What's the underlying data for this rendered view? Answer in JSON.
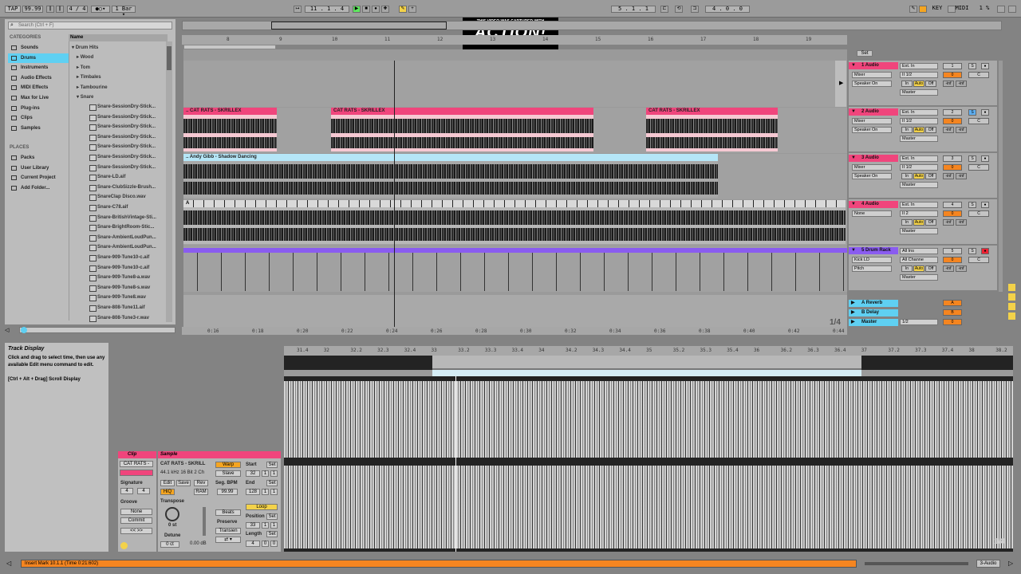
{
  "control_bar": {
    "tap": "TAP",
    "tempo": "99.99",
    "signature": "4 / 4",
    "quantize": "1 Bar",
    "position": "11 . 1 . 4",
    "loop_start": "5 . 1 . 1",
    "loop_length": "4 . 0 . 0",
    "key": "KEY",
    "midi": "MIDI",
    "cpu": "1 %"
  },
  "overlay": {
    "line1": "THIS VIDEO WAS CAPTURED WITH",
    "brand": "ACTION!",
    "url": "WWW.MIRILLIS.COM"
  },
  "browser": {
    "search_placeholder": "Search (Ctrl + F)",
    "categories_title": "CATEGORIES",
    "places_title": "PLACES",
    "name_header": "Name",
    "categories": [
      "Sounds",
      "Drums",
      "Instruments",
      "Audio Effects",
      "MIDI Effects",
      "Max for Live",
      "Plug-ins",
      "Clips",
      "Samples"
    ],
    "places": [
      "Packs",
      "User Library",
      "Current Project",
      "Add Folder..."
    ],
    "root": "Drum Hits",
    "folders": [
      "Wood",
      "Tom",
      "Timbales",
      "Tambourine",
      "Snare"
    ],
    "files": [
      "Snare-SessionDry-Stick...",
      "Snare-SessionDry-Stick...",
      "Snare-SessionDry-Stick...",
      "Snare-SessionDry-Stick...",
      "Snare-SessionDry-Stick...",
      "Snare-SessionDry-Stick...",
      "Snare-SessionDry-Stick...",
      "Snare-LD.aif",
      "Snare-ClubSizzle-Brush...",
      "SnareClap Disco.wav",
      "Snare-C78.aif",
      "Snare-BritishVintage-Sti...",
      "Snare-BrightRoom-Stic...",
      "Snare-AmbientLoudPun...",
      "Snare-AmbientLoudPun...",
      "Snare-909-Tune10-c.aif",
      "Snare-909-Tune10-c.aif",
      "Snare-909-Tune8-a.wav",
      "Snare-909-Tune8-s.wav",
      "Snare-909-Tune8.wav",
      "Snare-808-Tune11.aif",
      "Snare-808-Tune3-r.wav"
    ]
  },
  "ruler": [
    "8",
    "9",
    "10",
    "11",
    "12",
    "13",
    "14",
    "15",
    "16",
    "17",
    "18",
    "19"
  ],
  "time_ruler": [
    "0:16",
    "0:18",
    "0:20",
    "0:22",
    "0:24",
    "0:26",
    "0:28",
    "0:30",
    "0:32",
    "0:34",
    "0:36",
    "0:38",
    "0:40",
    "0:42",
    "0:44"
  ],
  "clips": {
    "track2": "CAT RATS - SKRILLEX",
    "track3": "Andy Gibb - Shadow Dancing",
    "track4_slice": "A"
  },
  "grid_fraction": "1/4",
  "tracks": [
    {
      "name": "1 Audio",
      "color": "#f0457c",
      "input": "Ext. In",
      "channel": "II 1/2",
      "monitor": "Mixer",
      "output": "Speaker On",
      "dest": "Master",
      "num": "1",
      "vol": "0",
      "pan": "C",
      "inf1": "-inf",
      "inf2": "-inf"
    },
    {
      "name": "2 Audio",
      "color": "#f0457c",
      "input": "Ext. In",
      "channel": "II 1/2",
      "monitor": "Mixer",
      "output": "Speaker On",
      "dest": "Master",
      "num": "2",
      "vol": "0",
      "pan": "C",
      "inf1": "-inf",
      "inf2": "-inf"
    },
    {
      "name": "3 Audio",
      "color": "#f0457c",
      "input": "Ext. In",
      "channel": "II 1/2",
      "monitor": "Mixer",
      "output": "Speaker On",
      "dest": "Master",
      "num": "3",
      "vol": "0",
      "pan": "C",
      "inf1": "-inf",
      "inf2": "-inf"
    },
    {
      "name": "4 Audio",
      "color": "#f0457c",
      "input": "Ext. In",
      "channel": "II 2",
      "monitor": "None",
      "output": "",
      "dest": "Master",
      "num": "4",
      "vol": "0",
      "pan": "C",
      "inf1": "-inf",
      "inf2": "-inf"
    },
    {
      "name": "5 Drum Rack",
      "color": "#8a5cf0",
      "input": "All Ins",
      "channel": "All Channe",
      "monitor": "Kick LD",
      "output": "Pitch",
      "dest": "Master",
      "num": "5",
      "vol": "0",
      "pan": "C",
      "inf1": "-inf",
      "inf2": "-inf"
    }
  ],
  "returns": [
    {
      "name": "A Reverb",
      "letter": "A"
    },
    {
      "name": "B Delay",
      "letter": "B"
    },
    {
      "name": "Master",
      "letter": "0",
      "dest": "1/2"
    }
  ],
  "io_labels": {
    "in": "In",
    "auto": "Auto",
    "off": "Off"
  },
  "info_view": {
    "title": "Track Display",
    "text": "Click and drag to select time, then use any available Edit menu command to edit.",
    "shortcut": "[Ctrl + Alt + Drag] Scroll Display"
  },
  "clip_view": {
    "clip_title": "Clip",
    "clip_name": "CAT RATS -",
    "signature_label": "Signature",
    "sig_num": "4",
    "sig_den": "4",
    "groove_label": "Groove",
    "groove_value": "None",
    "commit": "Commit",
    "sample_title": "Sample",
    "sample_name": "CAT RATS - SKRILL",
    "sample_info": "44.1 kHz 16 Bit 2 Ch",
    "edit": "Edit",
    "save": "Save",
    "rev": "Rev",
    "hiq": "HiQ",
    "ram": "RAM",
    "transpose_label": "Transpose",
    "transpose_value": "0 st",
    "detune_label": "Detune",
    "detune_value": "0 ct",
    "gain_value": "0.00 dB",
    "warp": "Warp",
    "slave": "Slave",
    "seg_bpm_label": "Seg. BPM",
    "seg_bpm": "99.99",
    "beats": "Beats",
    "preserve": "Preserve",
    "transients": "Transien",
    "start_label": "Start",
    "start": "32",
    "end_label": "End",
    "end": "128",
    "loop": "Loop",
    "position_label": "Position",
    "position": "33",
    "length_label": "Length",
    "length": "4",
    "set": "Set",
    "val_1": "1",
    "val_0": "0"
  },
  "sample_ruler": [
    "31.4",
    "32",
    "32.2",
    "32.3",
    "32.4",
    "33",
    "33.2",
    "33.3",
    "33.4",
    "34",
    "34.2",
    "34.3",
    "34.4",
    "35",
    "35.2",
    "35.3",
    "35.4",
    "36",
    "36.2",
    "36.3",
    "36.4",
    "37",
    "37.2",
    "37.3",
    "37.4",
    "38",
    "38.2"
  ],
  "sample_grid_fraction": "1/8",
  "status": {
    "message": "Insert Mark 10.1.1 (Time 0:21:602)",
    "track": "3-Audio"
  }
}
